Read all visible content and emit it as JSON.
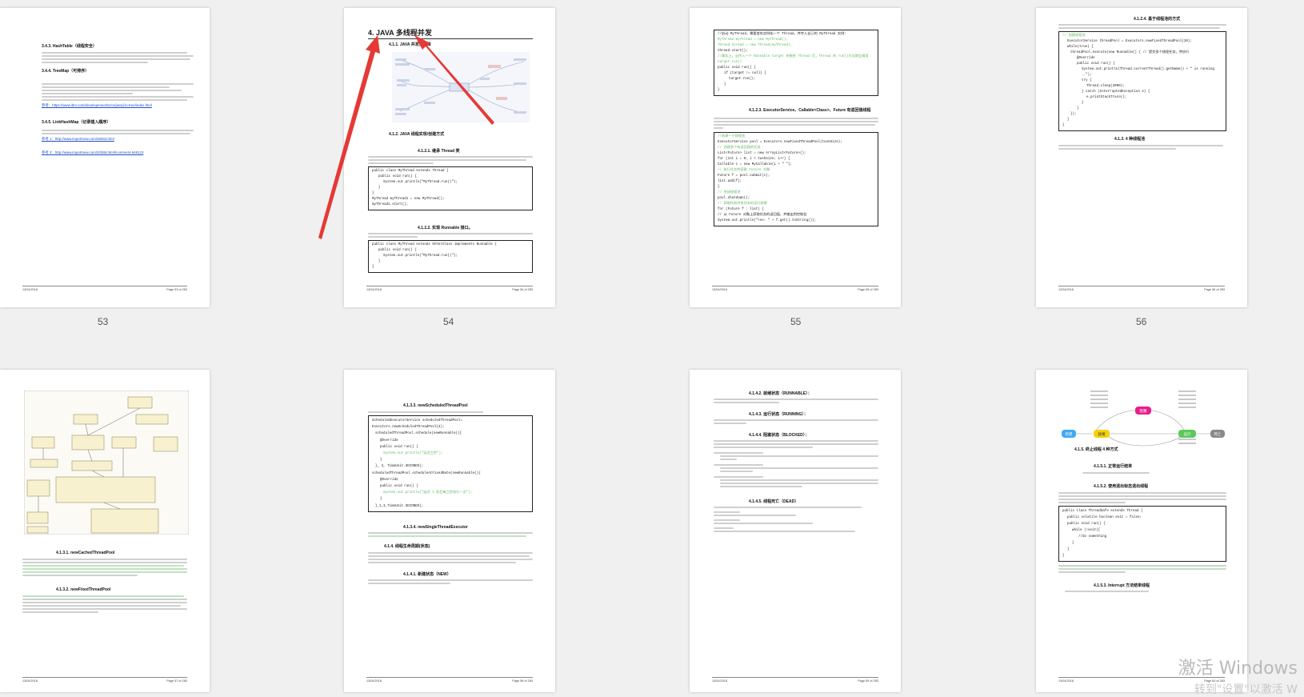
{
  "thumbnails": [
    {
      "page_label": "53"
    },
    {
      "page_label": "54"
    },
    {
      "page_label": "55"
    },
    {
      "page_label": "56"
    },
    {
      "page_label": ""
    },
    {
      "page_label": ""
    },
    {
      "page_label": ""
    },
    {
      "page_label": ""
    }
  ],
  "p53": {
    "h1": "3.4.3. HashTable（线程安全）",
    "h2": "3.4.4. TreeMap（可排序）",
    "h3": "3.4.5. LinkHashMap（记录插入顺序）",
    "link1": "参考：https://www.ibm.com/developerworks/cn/java/j-lo-tree/index.html",
    "link2": "参考 1：http://www.importnew.com/28263.html",
    "link3": "参考 2：http://www.importnew.com/20386.html#comment-648123",
    "footer_left": "13/04/2018",
    "footer_right": "Page 53 of 283"
  },
  "p54": {
    "title": "4. JAVA 多线程并发",
    "h1": "4.1.1. JAVA 并发知识库",
    "h2": "4.1.2. JAVA 线程实现/创建方式",
    "h3": "4.1.2.1. 继承 Thread 类",
    "code1": [
      "public class MyThread extends Thread {",
      "public void run() {",
      "System.out.println(\"MyThread.run()\");",
      "}",
      "}",
      "MyThread myThread1 = new MyThread();",
      "myThread1.start();"
    ],
    "h4": "4.1.2.2. 实现 Runnable 接口。",
    "code2": [
      "public class MyThread extends OtherClass implements Runnable {",
      "public void run() {",
      "System.out.println(\"MyThread.run()\");",
      "}",
      "}"
    ],
    "footer_left": "13/04/2018",
    "footer_right": "Page 54 of 283"
  },
  "p55": {
    "code1": [
      "//启动 MyThread，需要首先实例化一个 Thread，并传入自己的 MyThread 实例：",
      "MyThread myThread = new MyThread();",
      "Thread thread = new Thread(myThread);",
      "thread.start();",
      "//事实上，当传入一个 Runnable target 参数给 Thread 后，Thread 的 run()方法就会调用",
      "target.run()",
      "public void run() {",
      "if (target != null) {",
      "target.run();",
      "}",
      "}"
    ],
    "h1": "4.1.2.3. ExecutorService、Callable<Class>、Future 有返回值线程",
    "code2": [
      "//创建一个线程池",
      "ExecutorService pool = Executors.newFixedThreadPool(taskSize);",
      "// 创建多个有返回值的任务",
      "List<Future> list = new ArrayList<Future>();",
      "for (int i = 0; i < taskSize; i++) {",
      "Callable c = new MyCallable(i + \" \");",
      "// 执行任务并获取 Future 对象",
      "Future f = pool.submit(c);",
      "list.add(f);",
      "}",
      "// 关闭线程池",
      "pool.shutdown();",
      "// 获取所有并发任务的运行结果",
      "for (Future f : list) {",
      "// 从 Future 对象上获取任务的返回值，并输出到控制台",
      "System.out.println(\"res: \" + f.get().toString());"
    ],
    "footer_left": "13/04/2018",
    "footer_right": "Page 55 of 283"
  },
  "p56": {
    "h1": "4.1.2.4. 基于线程池的方式",
    "code1": [
      "// 创建线程池",
      "ExecutorService threadPool = Executors.newFixedThreadPool(10);",
      "while(true) {",
      "threadPool.execute(new Runnable() { // 提交多个线程任务，并执行",
      "@Override",
      "public void run() {",
      "System.out.println(Thread.currentThread().getName() + \" is running ..\");",
      "try {",
      "Thread.sleep(3000);",
      "} catch (InterruptedException e) {",
      "e.printStackTrace();",
      "}",
      "}",
      "});",
      "}",
      "}"
    ],
    "h2": "4.1.3. 4 种线程池",
    "footer_left": "13/04/2018",
    "footer_right": "Page 56 of 283"
  },
  "p57": {
    "h1": "4.1.3.1. newCachedThreadPool",
    "h2": "4.1.3.2. newFixedThreadPool",
    "footer_left": "13/04/2018",
    "footer_right": "Page 57 of 283"
  },
  "p58": {
    "h1": "4.1.3.3. newScheduledThreadPool",
    "code1": [
      "ScheduledExecutorService scheduledThreadPool= Executors.newScheduledThreadPool(3);",
      "scheduledThreadPool.schedule(newRunnable(){",
      "@Override",
      "public void run() {",
      "System.out.println(\"延迟三秒\");",
      "}",
      "}, 3, TimeUnit.SECONDS);",
      "scheduledThreadPool.scheduleAtFixedRate(newRunnable(){",
      "@Override",
      "public void run() {",
      "System.out.println(\"延迟 1 秒后每三秒执行一次\");",
      "}",
      "},1,3,TimeUnit.SECONDS);"
    ],
    "h2": "4.1.3.4. newSingleThreadExecutor",
    "h3": "4.1.4. 线程生命周期(状态)",
    "h4": "4.1.4.1. 新建状态（NEW）",
    "footer_left": "13/04/2018",
    "footer_right": "Page 58 of 283"
  },
  "p59": {
    "h1": "4.1.4.2. 就绪状态（RUNNABLE）：",
    "h2": "4.1.4.3. 运行状态（RUNNING）：",
    "h3": "4.1.4.4. 阻塞状态（BLOCKED）：",
    "h4": "4.1.4.5. 线程死亡（DEAD）",
    "footer_left": "13/04/2018",
    "footer_right": "Page 59 of 283"
  },
  "p60": {
    "diagram_states": [
      "新建",
      "就绪",
      "运行",
      "死亡"
    ],
    "diagram_block": "阻塞",
    "h1": "4.1.5. 终止线程 4 种方式",
    "h2": "4.1.5.1. 正常运行结束",
    "h3": "4.1.5.2. 使用退出标志退出线程",
    "code1": [
      "public class ThreadSafe extends Thread {",
      "public volatile boolean exit = false;",
      "public void run() {",
      "while (!exit){",
      "//do something",
      "}",
      "}",
      "}"
    ],
    "h4": "4.1.5.3. Interrupt 方法结束线程",
    "footer_left": "13/04/2018",
    "footer_right": "Page 60 of 283"
  },
  "watermark": {
    "line1": "激活 Windows",
    "line2": "转到\"设置\"以激活 W"
  },
  "colors": {
    "arrow": "#e53935",
    "green_text": "#5cb85c",
    "link_blue": "#1f4fc9"
  }
}
